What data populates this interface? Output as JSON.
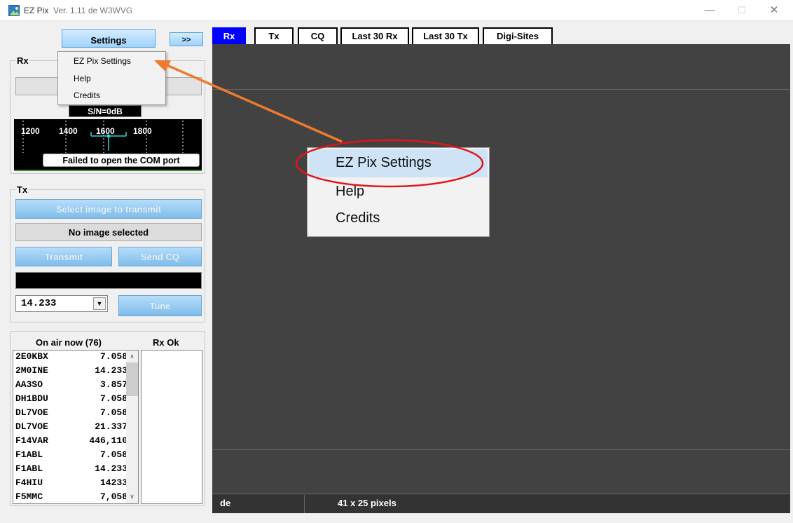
{
  "titlebar": {
    "app_name": "EZ Pix",
    "version": "Ver. 1.11 de W3WVG",
    "minimize_glyph": "—",
    "maximize_glyph": "☐",
    "close_glyph": "✕"
  },
  "toolbar": {
    "settings_label": "Settings",
    "expand_label": ">>"
  },
  "settings_menu": {
    "items": [
      "EZ Pix Settings",
      "Help",
      "Credits"
    ],
    "highlighted": "EZ Pix Settings"
  },
  "rx": {
    "group_label": "Rx",
    "sn_text": "S/N=0dB",
    "freq_ticks": [
      "1200",
      "1400",
      "1600",
      "1800"
    ],
    "com_status": "Failed to open the COM port"
  },
  "tx": {
    "group_label": "Tx",
    "select_image_label": "Select image to transmit",
    "no_image_label": "No image selected",
    "transmit_label": "Transmit",
    "send_cq_label": "Send CQ",
    "frequency_value": "14.233",
    "dropdown_glyph": "▼",
    "tune_label": "Tune"
  },
  "on_air": {
    "header": "On air now (76)",
    "rx_ok_header": "Rx Ok",
    "stations": [
      {
        "call": "2E0KBX",
        "freq": "7.058"
      },
      {
        "call": "2M0INE",
        "freq": "14.233"
      },
      {
        "call": "AA3SO",
        "freq": "3.857"
      },
      {
        "call": "DH1BDU",
        "freq": "7.058"
      },
      {
        "call": "DL7VOE",
        "freq": "7.058"
      },
      {
        "call": "DL7VOE",
        "freq": "21.337"
      },
      {
        "call": "F14VAR",
        "freq": "446,110"
      },
      {
        "call": "F1ABL",
        "freq": "7.058"
      },
      {
        "call": "F1ABL",
        "freq": "14.233"
      },
      {
        "call": "F4HIU",
        "freq": "14233"
      },
      {
        "call": "F5MMC",
        "freq": "7,058"
      }
    ],
    "scroll_up": "∧",
    "scroll_down": "∨"
  },
  "tabs": [
    "Rx",
    "Tx",
    "CQ",
    "Last 30 Rx",
    "Last 30 Tx",
    "Digi-Sites"
  ],
  "active_tab": "Rx",
  "status_bar": {
    "callsign_field": "de",
    "image_size": "41 x 25 pixels"
  },
  "callout": {
    "items": [
      "EZ Pix Settings",
      "Help",
      "Credits"
    ],
    "circle_color": "#e0161b",
    "arrow_color": "#ee7a2e"
  }
}
